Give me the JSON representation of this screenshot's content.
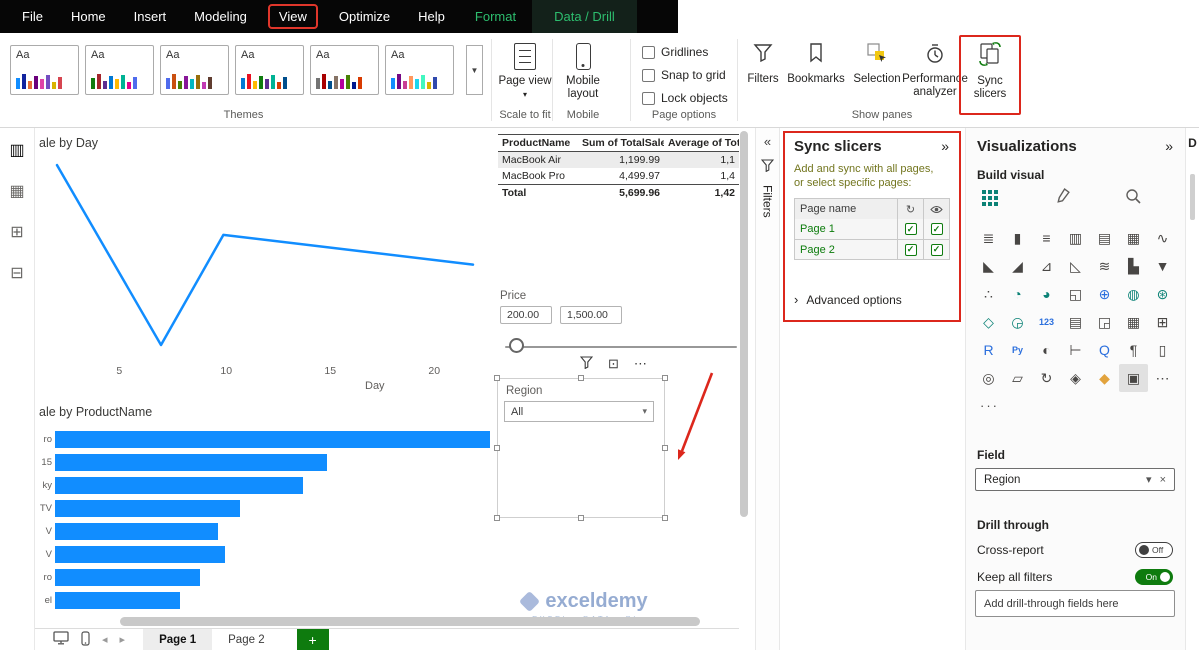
{
  "menu": {
    "items": [
      "File",
      "Home",
      "Insert",
      "Modeling",
      "View",
      "Optimize",
      "Help"
    ],
    "highlighted": "View",
    "format": "Format",
    "data_drill": "Data / Drill"
  },
  "ribbon": {
    "themes": {
      "label": "Themes",
      "card_text": "Aa",
      "palettes": [
        [
          "#118dff",
          "#12239e",
          "#e66c37",
          "#6b007b",
          "#e044a7",
          "#744ec2",
          "#d9b300",
          "#d64550"
        ],
        [
          "#107c10",
          "#a4262c",
          "#5c2d91",
          "#0078d4",
          "#ffb900",
          "#00b294",
          "#e3008c",
          "#4f6bed"
        ],
        [
          "#4f6bed",
          "#ca5010",
          "#498205",
          "#881798",
          "#00b7c3",
          "#986f0b",
          "#c239b3",
          "#603d30"
        ],
        [
          "#0078d4",
          "#e81123",
          "#ffb900",
          "#107c10",
          "#5c2d91",
          "#00b294",
          "#d83b01",
          "#004e8c"
        ],
        [
          "#737373",
          "#a80000",
          "#004e8c",
          "#867365",
          "#b4009e",
          "#498205",
          "#00188f",
          "#d83b01"
        ],
        [
          "#118dff",
          "#750985",
          "#c83d95",
          "#ff985e",
          "#1dd5ee",
          "#42f7c0",
          "#d9b300",
          "#3049ad"
        ]
      ]
    },
    "page_view": {
      "label": "Page view",
      "group": "Scale to fit"
    },
    "mobile": {
      "label": "Mobile layout",
      "group": "Mobile"
    },
    "page_options": {
      "options": [
        "Gridlines",
        "Snap to grid",
        "Lock objects"
      ],
      "group": "Page options"
    },
    "show_panes": {
      "filters": "Filters",
      "bookmarks": "Bookmarks",
      "selection": "Selection",
      "performance": "Performance analyzer",
      "sync": "Sync slicers",
      "group": "Show panes"
    }
  },
  "left_rail": {
    "icons": [
      {
        "n": "report-view-icon",
        "g": "▥"
      },
      {
        "n": "data-view-icon",
        "g": "▦"
      },
      {
        "n": "model-view-icon",
        "g": "⊞"
      },
      {
        "n": "dax-query-view-icon",
        "g": "⊟"
      }
    ]
  },
  "canvas": {
    "line_chart": {
      "title": "ale by Day",
      "x_label": "Day",
      "x_ticks": [
        5,
        10,
        15,
        20
      ],
      "points": [
        [
          2,
          91
        ],
        [
          7,
          6
        ],
        [
          10,
          58
        ],
        [
          22,
          44
        ]
      ]
    },
    "table": {
      "headers": [
        "ProductName",
        "Sum of TotalSale",
        "Average of Tota"
      ],
      "rows": [
        [
          "MacBook Air",
          "1,199.99",
          "1,1"
        ],
        [
          "MacBook Pro",
          "4,499.97",
          "1,4"
        ]
      ],
      "total_row": [
        "Total",
        "5,699.96",
        "1,42"
      ]
    },
    "price_slicer": {
      "title": "Price",
      "min_value": "200.00",
      "max_value": "1,500.00"
    },
    "region_slicer": {
      "title": "Region",
      "value": "All"
    },
    "bar_chart": {
      "title": "ale by ProductName",
      "labels": [
        "ro",
        "15",
        "ky",
        "TV",
        "V",
        "V",
        "ro",
        "el"
      ],
      "values": [
        1,
        0.625,
        0.57,
        0.425,
        0.375,
        0.391,
        0.333,
        0.287
      ]
    },
    "watermark": {
      "name": "exceldemy",
      "tagline": "EXCEL · DATA · BI"
    }
  },
  "chart_data": [
    {
      "type": "line",
      "title": "ale by Day",
      "xlabel": "Day",
      "x_ticks": [
        5,
        10,
        15,
        20
      ],
      "x": [
        2,
        7,
        10,
        22
      ],
      "y_relative": [
        91,
        6,
        58,
        44
      ]
    },
    {
      "type": "bar",
      "title": "ale by ProductName",
      "categories": [
        "ro",
        "15",
        "ky",
        "TV",
        "V",
        "V",
        "ro",
        "el"
      ],
      "values_relative": [
        1,
        0.625,
        0.57,
        0.425,
        0.375,
        0.391,
        0.333,
        0.287
      ]
    },
    {
      "type": "table",
      "headers": [
        "ProductName",
        "Sum of TotalSale",
        "Average of Tota"
      ],
      "rows": [
        [
          "MacBook Air",
          "1,199.99",
          "1,1"
        ],
        [
          "MacBook Pro",
          "4,499.97",
          "1,4"
        ],
        [
          "Total",
          "5,699.96",
          "1,42"
        ]
      ]
    }
  ],
  "pages": {
    "tabs": [
      "Page 1",
      "Page 2"
    ],
    "active": "Page 1"
  },
  "filters_pane": {
    "label": "Filters",
    "expand_glyph": "«"
  },
  "sync_pane": {
    "title": "Sync slicers",
    "collapse_glyph": "»",
    "hint": [
      "Add and sync with all pages,",
      "or select specific pages:"
    ],
    "column_header": "Page name",
    "rows": [
      {
        "name": "Page 1",
        "sync": true,
        "visible": true
      },
      {
        "name": "Page 2",
        "sync": true,
        "visible": true
      }
    ],
    "advanced_label": "Advanced options"
  },
  "viz_pane": {
    "title": "Visualizations",
    "collapse_glyph": "»",
    "build_label": "Build visual",
    "icons": [
      {
        "n": "stacked-bar-chart-icon",
        "g": "≣"
      },
      {
        "n": "stacked-column-chart-icon",
        "g": "▮"
      },
      {
        "n": "clustered-bar-chart-icon",
        "g": "≡"
      },
      {
        "n": "clustered-column-chart-icon",
        "g": "▥"
      },
      {
        "n": "hundred-stacked-bar-chart-icon",
        "g": "▤"
      },
      {
        "n": "hundred-stacked-column-chart-icon",
        "g": "▦"
      },
      {
        "n": "line-chart-icon",
        "g": "∿"
      },
      {
        "n": "area-chart-icon",
        "g": "◣"
      },
      {
        "n": "stacked-area-chart-icon",
        "g": "◢"
      },
      {
        "n": "line-stacked-column-chart-icon",
        "g": "⊿"
      },
      {
        "n": "line-clustered-column-chart-icon",
        "g": "◺"
      },
      {
        "n": "ribbon-chart-icon",
        "g": "≋"
      },
      {
        "n": "waterfall-chart-icon",
        "g": "▙"
      },
      {
        "n": "funnel-chart-icon",
        "g": "▼"
      },
      {
        "n": "scatter-chart-icon",
        "g": "∴"
      },
      {
        "n": "pie-chart-icon",
        "g": "◔",
        "c": "teal"
      },
      {
        "n": "donut-chart-icon",
        "g": "◕",
        "c": "teal"
      },
      {
        "n": "treemap-icon",
        "g": "◱"
      },
      {
        "n": "map-icon",
        "g": "⊕",
        "c": "blue"
      },
      {
        "n": "filled-map-icon",
        "g": "◍",
        "c": "teal"
      },
      {
        "n": "azure-map-icon",
        "g": "⊛",
        "c": "teal"
      },
      {
        "n": "shape-map-icon",
        "g": "◇",
        "c": "teal"
      },
      {
        "n": "gauge-icon",
        "g": "◶",
        "c": "teal"
      },
      {
        "n": "card-icon",
        "g": "123",
        "c": "blue"
      },
      {
        "n": "multi-row-card-icon",
        "g": "▤"
      },
      {
        "n": "kpi-icon",
        "g": "◲"
      },
      {
        "n": "table-icon",
        "g": "▦"
      },
      {
        "n": "matrix-icon",
        "g": "⊞"
      },
      {
        "n": "r-script-visual-icon",
        "g": "R",
        "c": "blue"
      },
      {
        "n": "python-visual-icon",
        "g": "Py",
        "c": "blue"
      },
      {
        "n": "key-influencers-icon",
        "g": "◐"
      },
      {
        "n": "decomposition-tree-icon",
        "g": "⊢"
      },
      {
        "n": "qa-visual-icon",
        "g": "Q",
        "c": "blue"
      },
      {
        "n": "smart-narrative-icon",
        "g": "¶"
      },
      {
        "n": "paginated-report-icon",
        "g": "▯"
      },
      {
        "n": "metrics-icon",
        "g": "◎"
      },
      {
        "n": "power-apps-icon",
        "g": "▱"
      },
      {
        "n": "power-automate-icon",
        "g": "↻"
      },
      {
        "n": "arcgis-map-icon",
        "g": "◈"
      },
      {
        "n": "custom-visual-icon",
        "g": "◆",
        "c": "yellow"
      },
      {
        "n": "slicer-icon",
        "g": "▣"
      },
      {
        "n": "get-more-visuals-icon",
        "g": "⋯"
      }
    ],
    "field_label": "Field",
    "field_value": "Region",
    "drill_label": "Drill through",
    "cross_report": {
      "label": "Cross-report",
      "state": "Off"
    },
    "keep_filters": {
      "label": "Keep all filters",
      "state": "On"
    },
    "drop_placeholder": "Add drill-through fields here"
  },
  "collapsed_right": {
    "label": "D"
  },
  "colors": {
    "accent": "#118dff",
    "green": "#107c10",
    "annotation_red": "#dc271c",
    "hint_olive": "#73761f",
    "teal": "#0b8276",
    "blue_icon": "#2b6fdd",
    "yellow_icon": "#e2a33d"
  }
}
